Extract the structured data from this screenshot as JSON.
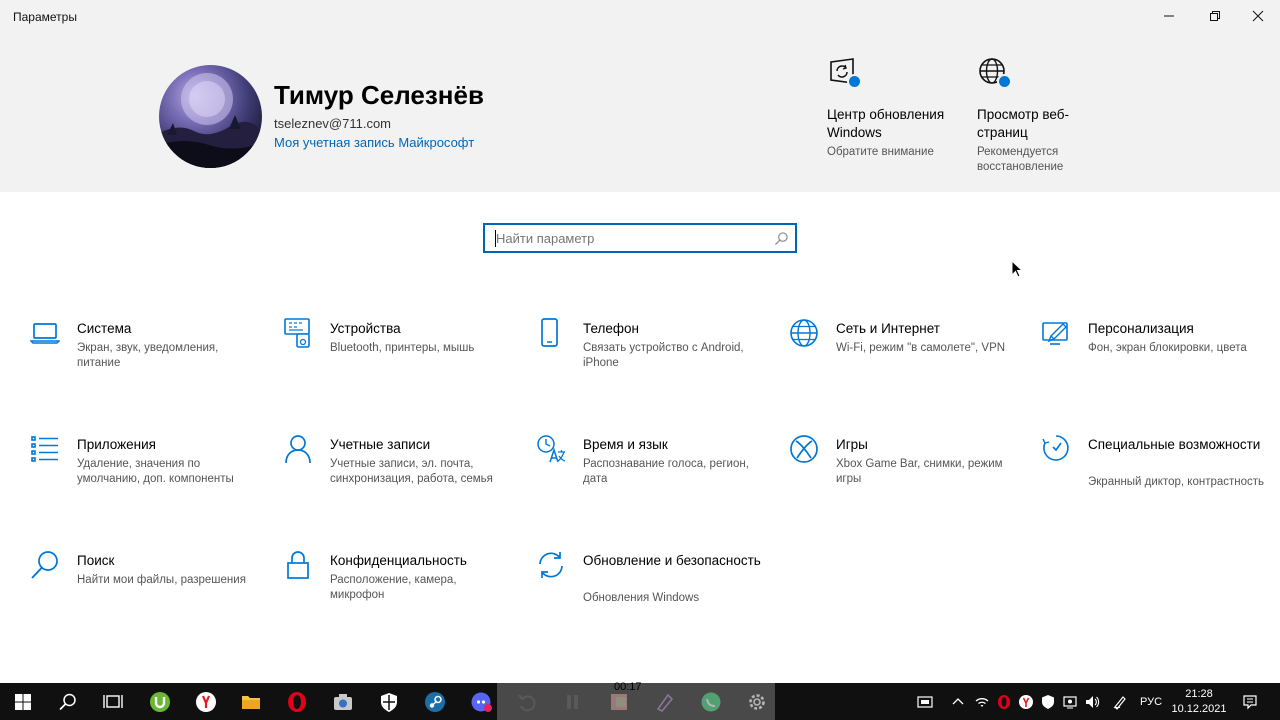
{
  "window": {
    "title": "Параметры"
  },
  "account": {
    "name": "Тимур Селезнёв",
    "email": "tseleznev@711.com",
    "link": "Моя учетная запись Майкрософт"
  },
  "status_tiles": [
    {
      "title": "Центр обновления Windows",
      "subtitle": "Обратите внимание",
      "icon": "windows-update-icon"
    },
    {
      "title": "Просмотр веб-страниц",
      "subtitle": "Рекомендуется восстановление",
      "icon": "globe-icon"
    }
  ],
  "search": {
    "placeholder": "Найти параметр"
  },
  "categories": [
    {
      "title": "Система",
      "subtitle": "Экран, звук, уведомления, питание",
      "icon": "laptop-icon"
    },
    {
      "title": "Устройства",
      "subtitle": "Bluetooth, принтеры, мышь",
      "icon": "devices-icon"
    },
    {
      "title": "Телефон",
      "subtitle": "Связать устройство с Android, iPhone",
      "icon": "phone-icon"
    },
    {
      "title": "Сеть и Интернет",
      "subtitle": "Wi-Fi, режим \"в самолете\", VPN",
      "icon": "globe-icon"
    },
    {
      "title": "Персонализация",
      "subtitle": "Фон, экран блокировки, цвета",
      "icon": "personalization-icon"
    },
    {
      "title": "Приложения",
      "subtitle": "Удаление, значения по умолчанию, доп. компоненты",
      "icon": "apps-list-icon"
    },
    {
      "title": "Учетные записи",
      "subtitle": "Учетные записи, эл. почта, синхронизация, работа, семья",
      "icon": "person-icon"
    },
    {
      "title": "Время и язык",
      "subtitle": "Распознавание голоса, регион, дата",
      "icon": "time-language-icon"
    },
    {
      "title": "Игры",
      "subtitle": "Xbox Game Bar, снимки, режим игры",
      "icon": "xbox-icon"
    },
    {
      "title": "Специальные возможности",
      "subtitle": "Экранный диктор, контрастность",
      "icon": "accessibility-icon"
    },
    {
      "title": "Поиск",
      "subtitle": "Найти мои файлы, разрешения",
      "icon": "search-icon"
    },
    {
      "title": "Конфиденциальность",
      "subtitle": "Расположение, камера, микрофон",
      "icon": "lock-icon"
    },
    {
      "title": "Обновление и безопасность",
      "subtitle": "Обновления Windows",
      "icon": "update-sync-icon"
    }
  ],
  "taskbar": {
    "media_time": "00:17",
    "language": "РУС",
    "time": "21:28",
    "date": "10.12.2021"
  },
  "colors": {
    "accent": "#0067b8",
    "icon_blue": "#0078d7",
    "header_bg": "#f2f2f2",
    "taskbar_bg": "#101010"
  }
}
